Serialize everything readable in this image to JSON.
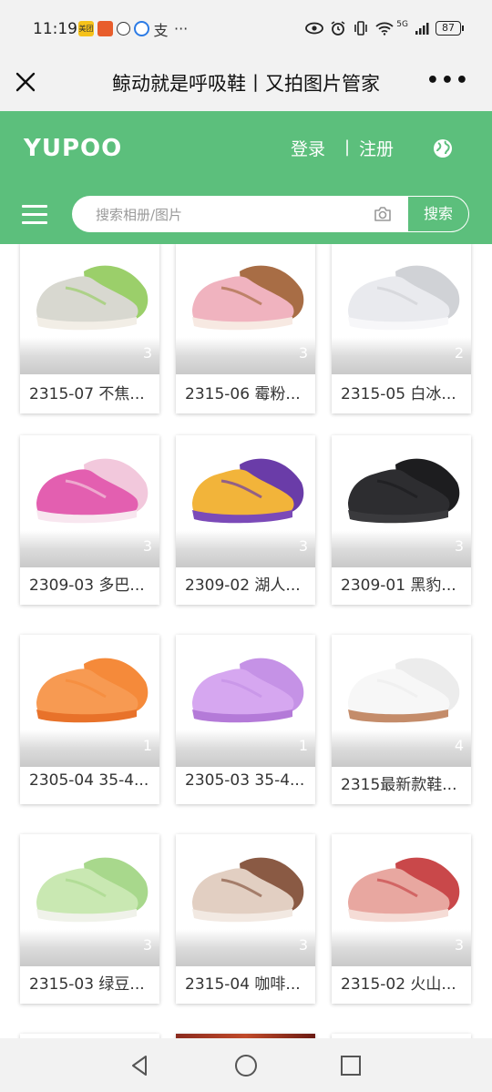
{
  "status": {
    "time": "11:19",
    "app_icon_label": "美团",
    "misc": "支",
    "more": "···",
    "network": "5G",
    "battery": "87"
  },
  "titlebar": {
    "title": "鲸动就是呼吸鞋丨又拍图片管家",
    "more": "•••"
  },
  "header": {
    "logo": "YUPOO",
    "login": "登录",
    "sep": "|",
    "register": "注册",
    "search_placeholder": "搜索相册/图片",
    "search_button": "搜索",
    "accent": "#5cbf7c"
  },
  "albums": [
    {
      "title": "2315-07 不焦...",
      "count": "3",
      "colors": [
        "#9bcf6a",
        "#d8d8d0",
        "#f2eee6"
      ]
    },
    {
      "title": "2315-06 霉粉...",
      "count": "3",
      "colors": [
        "#a86d45",
        "#f0b3bf",
        "#f7e9e2"
      ]
    },
    {
      "title": "2315-05 白冰...",
      "count": "2",
      "colors": [
        "#d0d2d6",
        "#e9eaee",
        "#f7f7f9"
      ]
    },
    {
      "title": "2309-03 多巴...",
      "count": "3",
      "colors": [
        "#f2c8dc",
        "#e35fb0",
        "#f8e6ef"
      ]
    },
    {
      "title": "2309-02 湖人...",
      "count": "3",
      "colors": [
        "#6a3ca8",
        "#f2b43a",
        "#7b4ab8"
      ]
    },
    {
      "title": "2309-01 黑豹...",
      "count": "3",
      "colors": [
        "#1d1d1f",
        "#2d2d30",
        "#3a3a3d"
      ]
    },
    {
      "title": "2305-04 35-4...",
      "count": "1",
      "colors": [
        "#f58a3a",
        "#f79a52",
        "#e8722a"
      ]
    },
    {
      "title": "2305-03 35-4...",
      "count": "1",
      "colors": [
        "#c592e6",
        "#d6a7f0",
        "#b47ad8"
      ]
    },
    {
      "title": "2315最新款鞋...",
      "count": "4",
      "colors": [
        "#ececec",
        "#f7f7f7",
        "#c48c6a"
      ]
    },
    {
      "title": "2315-03 绿豆...",
      "count": "3",
      "colors": [
        "#a8d88c",
        "#c9e8b2",
        "#f0f2ea"
      ]
    },
    {
      "title": "2315-04 咖啡...",
      "count": "3",
      "colors": [
        "#8a5a44",
        "#e2cfc2",
        "#f2e9e2"
      ]
    },
    {
      "title": "2315-02 火山...",
      "count": "3",
      "colors": [
        "#c9484a",
        "#e8a7a0",
        "#f5dcd6"
      ]
    }
  ]
}
